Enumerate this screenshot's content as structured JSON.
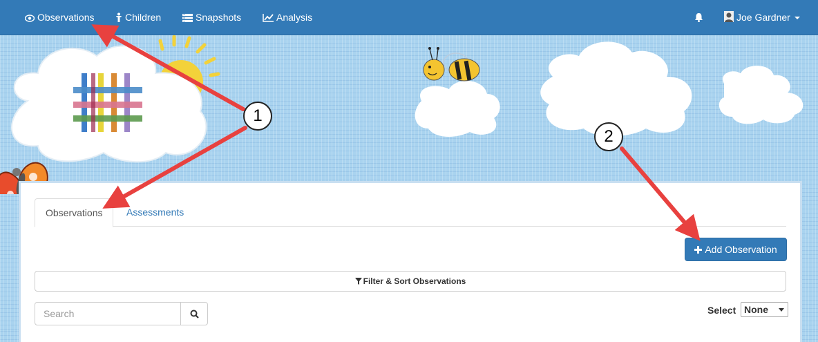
{
  "nav": {
    "items": [
      {
        "label": "Observations",
        "icon": "eye-icon"
      },
      {
        "label": "Children",
        "icon": "child-icon"
      },
      {
        "label": "Snapshots",
        "icon": "snapshots-icon"
      },
      {
        "label": "Analysis",
        "icon": "chart-line-icon"
      }
    ],
    "bell_icon": "bell-icon",
    "user": {
      "name": "Joe Gardner",
      "icon": "user-icon"
    }
  },
  "tabs": [
    {
      "label": "Observations",
      "active": true
    },
    {
      "label": "Assessments",
      "active": false
    }
  ],
  "toolbar": {
    "add_label": "Add Observation",
    "add_icon": "plus-icon",
    "filter_label": "Filter & Sort Observations",
    "filter_icon": "filter-icon"
  },
  "search": {
    "placeholder": "Search",
    "value": "",
    "icon": "search-icon"
  },
  "select": {
    "label": "Select",
    "value": "None"
  },
  "annotations": {
    "callout_1": "1",
    "callout_2": "2"
  },
  "colors": {
    "navbar": "#337ab7",
    "primary_button": "#337ab7",
    "annotation_arrow": "#e8413f",
    "background": "#a9d3ef"
  }
}
